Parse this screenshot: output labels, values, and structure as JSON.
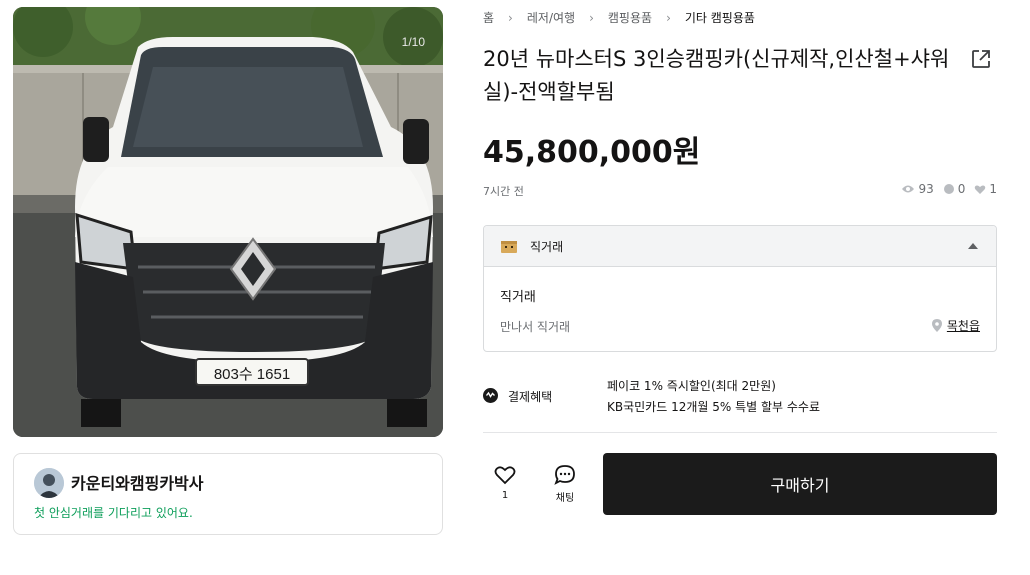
{
  "gallery": {
    "counter": "1/10",
    "plate": "803수 1651"
  },
  "seller": {
    "name": "카운티와캠핑카박사",
    "message": "첫 안심거래를 기다리고 있어요."
  },
  "breadcrumb": [
    "홈",
    "레저/여행",
    "캠핑용품",
    "기타 캠핑용품"
  ],
  "product": {
    "title": "20년 뉴마스터S 3인승캠핑카(신규제작,인산철+샤워실)-전액할부됨",
    "price": "45,800,000원",
    "posted": "7시간 전",
    "views": "93",
    "chats": "0",
    "likes": "1"
  },
  "trade": {
    "header": "직거래",
    "type": "직거래",
    "description": "만나서 직거래",
    "location": "목천읍"
  },
  "payment": {
    "label": "결제혜택",
    "line1": "페이코 1% 즉시할인(최대 2만원)",
    "line2": "KB국민카드 12개월 5% 특별 할부 수수료"
  },
  "actions": {
    "like_count": "1",
    "chat_label": "채팅",
    "buy_label": "구매하기"
  },
  "colors": {
    "accent_green": "#0d9e5a",
    "button_dark": "#1b1b1b"
  },
  "icons": [
    "share-icon",
    "eye-icon",
    "chat-bubble-icon",
    "heart-icon",
    "location-pin-icon",
    "payment-icon",
    "box-icon",
    "caret-up-icon"
  ]
}
